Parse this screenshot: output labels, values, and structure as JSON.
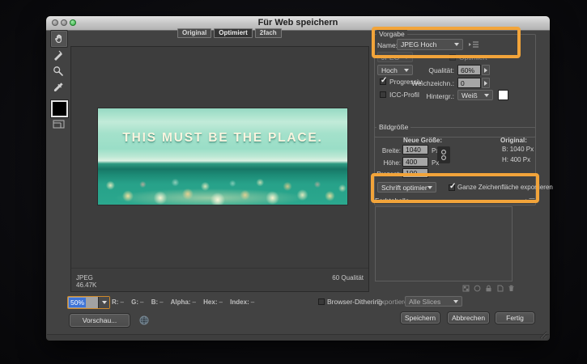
{
  "window": {
    "title": "Für Web speichern"
  },
  "tabs": [
    {
      "label": "Original",
      "active": false
    },
    {
      "label": "Optimiert",
      "active": true
    },
    {
      "label": "2fach",
      "active": false
    }
  ],
  "toolbar_icons": [
    "hand-icon",
    "slice-select-icon",
    "zoom-icon",
    "eyedropper-icon",
    "color-swatch",
    "toggle-slices-icon"
  ],
  "preview": {
    "image_caption": "THIS MUST BE THE PLACE.",
    "format": "JPEG",
    "file_size": "46.47K",
    "quality_info": "60 Qualität"
  },
  "zoom_level": {
    "value": "50%"
  },
  "readout": {
    "items": [
      {
        "label": "R:",
        "value": "–"
      },
      {
        "label": "G:",
        "value": "–"
      },
      {
        "label": "B:",
        "value": "–"
      },
      {
        "label": "Alpha:",
        "value": "–"
      },
      {
        "label": "Hex:",
        "value": "–"
      },
      {
        "label": "Index:",
        "value": "–"
      }
    ]
  },
  "browser_dithering_label": "Browser-Dithering",
  "preview_button_label": "Vorschau...",
  "vorgabe": {
    "group_label": "Vorgabe",
    "name_label": "Name:",
    "name_value": "JPEG Hoch",
    "format_value": "JPEG",
    "optimized_label": "Optimiert",
    "quality_preset_value": "Hoch",
    "quality_label": "Qualität:",
    "quality_value": "60%",
    "progressive_label": "Progressiv",
    "blur_label": "Weichzeichn.:",
    "blur_value": "0",
    "icc_label": "ICC-Profil",
    "matte_label": "Hintergr.:",
    "matte_value": "Weiß"
  },
  "bildgroesse": {
    "group_label": "Bildgröße",
    "new_size_label": "Neue Größe:",
    "width_label": "Breite:",
    "width_value": "1040",
    "width_unit": "Px",
    "height_label": "Höhe:",
    "height_value": "400",
    "height_unit": "Px",
    "percent_label": "Prozent:",
    "percent_value": "100",
    "original_label": "Original:",
    "original_width": "B:  1040 Px",
    "original_height": "H:  400 Px"
  },
  "export_options": {
    "quality_mode_value": "Schrift optimiert",
    "artboard_checkbox_label": "Ganze Zeichenfläche exportieren"
  },
  "farbtabelle_label": "Farbtabelle",
  "exportieren": {
    "label": "Exportieren:",
    "value": "Alle Slices"
  },
  "buttons": {
    "save": "Speichern",
    "cancel": "Abbrechen",
    "done": "Fertig"
  },
  "colors": {
    "highlight_orange": "#F2A43A",
    "selection_blue": "#3E74D6",
    "dialog_gray": "#424242"
  }
}
